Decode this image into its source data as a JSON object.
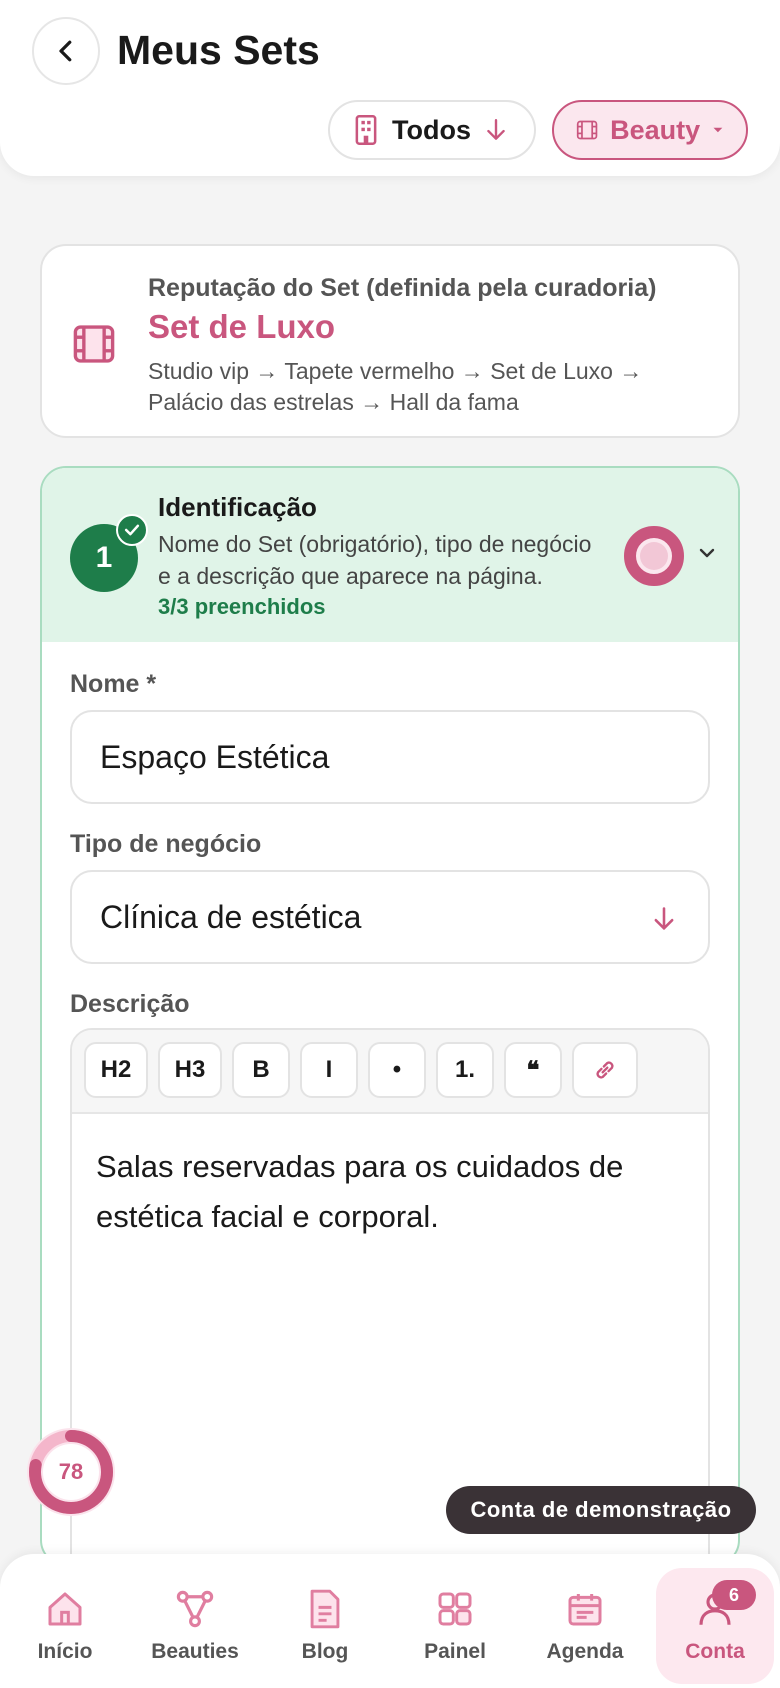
{
  "header": {
    "title": "Meus Sets",
    "back_icon": "chevron-left-icon",
    "filters": {
      "todos_label": "Todos",
      "beauty_label": "Beauty"
    }
  },
  "reputation": {
    "label": "Reputação do Set (definida pela curadoria)",
    "value": "Set de Luxo",
    "path": "Studio vip → Tapete vermelho → Set de Luxo → Palácio das estrelas → Hall da fama"
  },
  "section": {
    "step_number": "1",
    "title": "Identificação",
    "description": "Nome do Set (obrigatório), tipo de negócio e a descrição que aparece na página.",
    "count": "3/3 preenchidos"
  },
  "form": {
    "name_label": "Nome *",
    "name_value": "Espaço Estética",
    "type_label": "Tipo de negócio",
    "type_value": "Clínica de estética",
    "description_label": "Descrição",
    "toolbar": [
      "H2",
      "H3",
      "B",
      "I",
      "•",
      "1.",
      "❝"
    ],
    "description_value": "Salas reservadas para os cuidados de estética facial e corporal."
  },
  "score": "78",
  "demo_label": "Conta de demonstração",
  "nav": {
    "items": [
      {
        "label": "Início",
        "icon": "home-icon"
      },
      {
        "label": "Beauties",
        "icon": "network-icon"
      },
      {
        "label": "Blog",
        "icon": "document-icon"
      },
      {
        "label": "Painel",
        "icon": "grid-icon"
      },
      {
        "label": "Agenda",
        "icon": "calendar-icon"
      },
      {
        "label": "Conta",
        "icon": "user-icon"
      }
    ],
    "badge": "6"
  },
  "colors": {
    "accent": "#c9567e",
    "success": "#1e7d4a",
    "success_bg": "#e0f4e8"
  }
}
